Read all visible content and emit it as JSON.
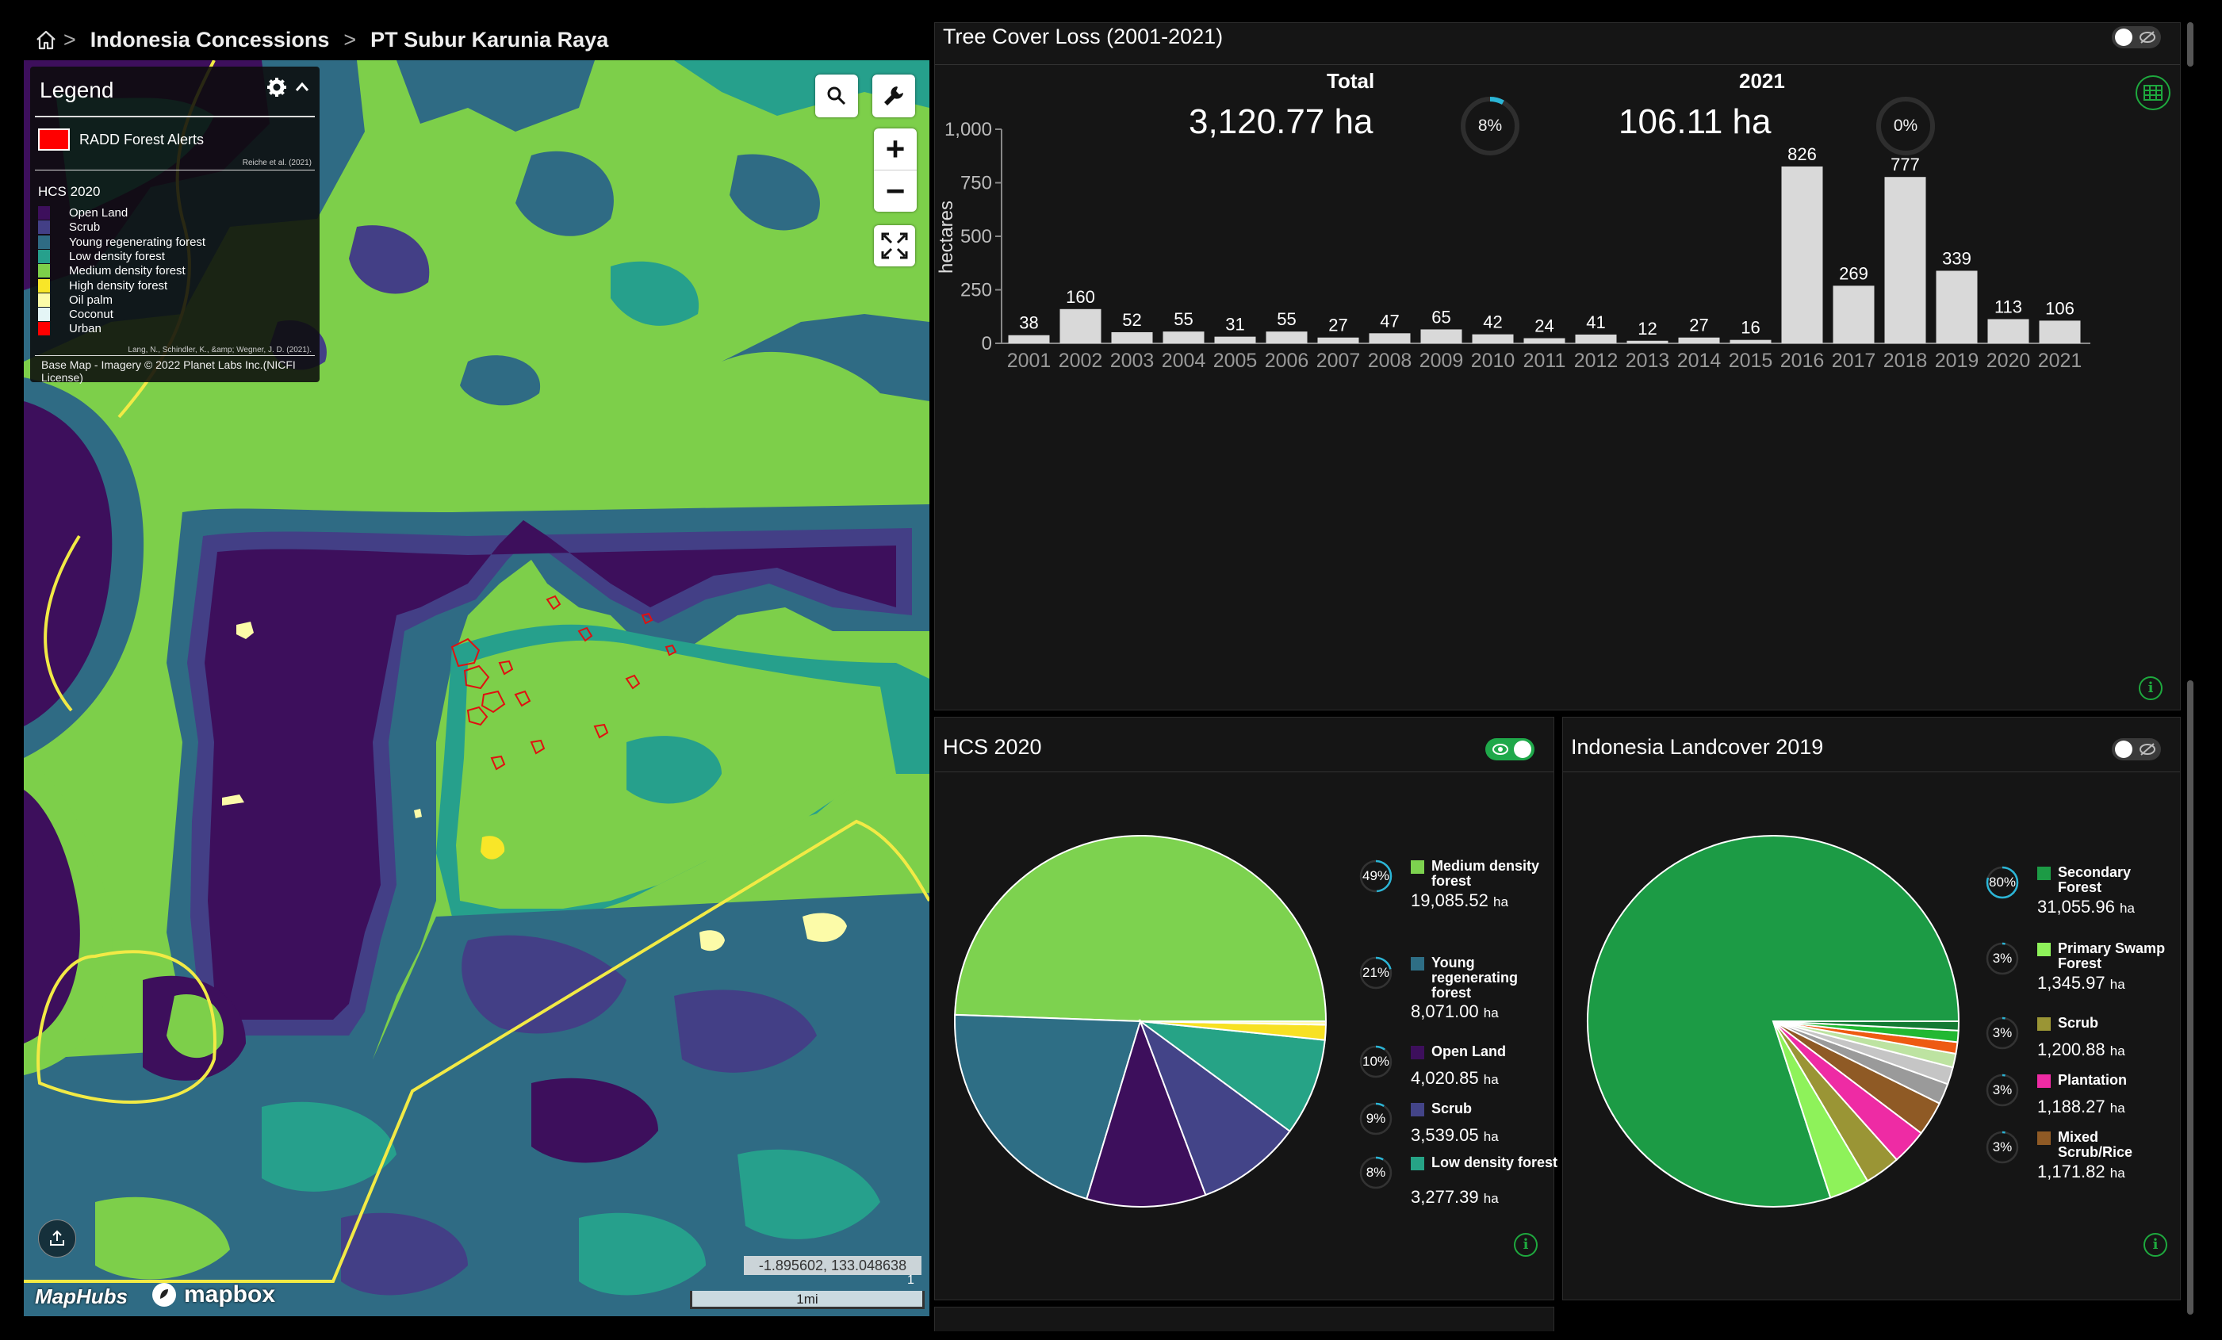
{
  "breadcrumb": {
    "home_icon": "home-icon",
    "items": [
      "Indonesia Concessions",
      "PT Subur Karunia Raya"
    ],
    "separator": ">"
  },
  "map": {
    "legend": {
      "title": "Legend",
      "radd_label": "RADD Forest Alerts",
      "radd_color": "#ff0000",
      "radd_credit": "Reiche et al. (2021)",
      "hcs_title": "HCS 2020",
      "hcs_items": [
        {
          "label": "Open Land",
          "color": "#3d0f5c"
        },
        {
          "label": "Scrub",
          "color": "#433f86"
        },
        {
          "label": "Young regenerating forest",
          "color": "#2f6b84"
        },
        {
          "label": "Low density forest",
          "color": "#26a08c"
        },
        {
          "label": "Medium density forest",
          "color": "#7dcf4a"
        },
        {
          "label": "High density forest",
          "color": "#f8e628"
        },
        {
          "label": "Oil palm",
          "color": "#fcfba8"
        },
        {
          "label": "Coconut",
          "color": "#e4f5f6"
        },
        {
          "label": "Urban",
          "color": "#ff0000"
        }
      ],
      "hcs_credit": "Lang, N., Schindler, K., &amp; Wegner, J. D. (2021).",
      "basemap_credit": "Base Map - Imagery © 2022 Planet Labs Inc.(NICFI License)"
    },
    "coordinates": "-1.895602, 133.048638",
    "scale_label": "1mi",
    "scale_label_right": "1",
    "logo_maphubs": "MapHubs",
    "logo_mapbox": "mapbox",
    "zoom_in": "+",
    "zoom_out": "−"
  },
  "tree_cover": {
    "title": "Tree Cover Loss (2001-2021)",
    "total_label": "Total",
    "total_value": "3,120.77 ha",
    "total_pct": "8%",
    "total_pct_value": 8,
    "year_label": "2021",
    "year_value": "106.11 ha",
    "year_pct": "0%",
    "year_pct_value": 0,
    "table_icon": "table-icon"
  },
  "chart_data": {
    "type": "bar",
    "title": "Tree Cover Loss (2001-2021)",
    "xlabel": "",
    "ylabel": "hectares",
    "ylim": [
      0,
      1000
    ],
    "yticks": [
      "0",
      "250",
      "500",
      "750",
      "1,000"
    ],
    "ytick_values": [
      0,
      250,
      500,
      750,
      1000
    ],
    "categories": [
      "2001",
      "2002",
      "2003",
      "2004",
      "2005",
      "2006",
      "2007",
      "2008",
      "2009",
      "2010",
      "2011",
      "2012",
      "2013",
      "2014",
      "2015",
      "2016",
      "2017",
      "2018",
      "2019",
      "2020",
      "2021"
    ],
    "values": [
      38,
      160,
      52,
      55,
      31,
      55,
      27,
      47,
      65,
      42,
      24,
      41,
      12,
      27,
      16,
      826,
      269,
      777,
      339,
      113,
      106
    ],
    "bar_color": "#d9d9d9"
  },
  "hcs_panel": {
    "title": "HCS 2020",
    "toggle_on": true,
    "pie": [
      {
        "name": "Medium density forest",
        "pct": "49%",
        "value": "19,085.52",
        "unit": "ha",
        "color": "#7dd24f",
        "share": 0.49
      },
      {
        "name": "Young regenerating forest",
        "pct": "21%",
        "value": "8,071.00",
        "unit": "ha",
        "color": "#2e6e85",
        "share": 0.207
      },
      {
        "name": "Open Land",
        "pct": "10%",
        "value": "4,020.85",
        "unit": "ha",
        "color": "#3d0f5c",
        "share": 0.103
      },
      {
        "name": "Scrub",
        "pct": "9%",
        "value": "3,539.05",
        "unit": "ha",
        "color": "#434488",
        "share": 0.091
      },
      {
        "name": "Low density forest",
        "pct": "8%",
        "value": "3,277.39",
        "unit": "ha",
        "color": "#26a386",
        "share": 0.084
      }
    ],
    "pie_other": [
      {
        "color": "#f7e123",
        "share": 0.013
      },
      {
        "color": "#fffbb0",
        "share": 0.003
      }
    ]
  },
  "landcover_panel": {
    "title": "Indonesia Landcover 2019",
    "toggle_on": false,
    "pie": [
      {
        "name": "Secondary Forest",
        "pct": "80%",
        "value": "31,055.96",
        "unit": "ha",
        "color": "#1c9b45",
        "share": 0.8
      },
      {
        "name": "Primary Swamp Forest",
        "pct": "3%",
        "value": "1,345.97",
        "unit": "ha",
        "color": "#8ef25a",
        "share": 0.035
      },
      {
        "name": "Scrub",
        "pct": "3%",
        "value": "1,200.88",
        "unit": "ha",
        "color": "#9a9535",
        "share": 0.031
      },
      {
        "name": "Plantation",
        "pct": "3%",
        "value": "1,188.27",
        "unit": "ha",
        "color": "#ee2ba4",
        "share": 0.031
      },
      {
        "name": "Mixed Scrub/Rice",
        "pct": "3%",
        "value": "1,171.82",
        "unit": "ha",
        "color": "#8f5a25",
        "share": 0.03
      }
    ],
    "pie_other": [
      {
        "color": "#9a9a9a",
        "share": 0.018
      },
      {
        "color": "#c5c5c5",
        "share": 0.015
      },
      {
        "color": "#bde3a1",
        "share": 0.012
      },
      {
        "color": "#ee5a12",
        "share": 0.01
      },
      {
        "color": "#22b832",
        "share": 0.01
      },
      {
        "color": "#147a34",
        "share": 0.008
      }
    ]
  },
  "colors": {
    "accent": "#1ea93e",
    "ring": "#2bb5d6",
    "panel_bg": "#151515"
  }
}
